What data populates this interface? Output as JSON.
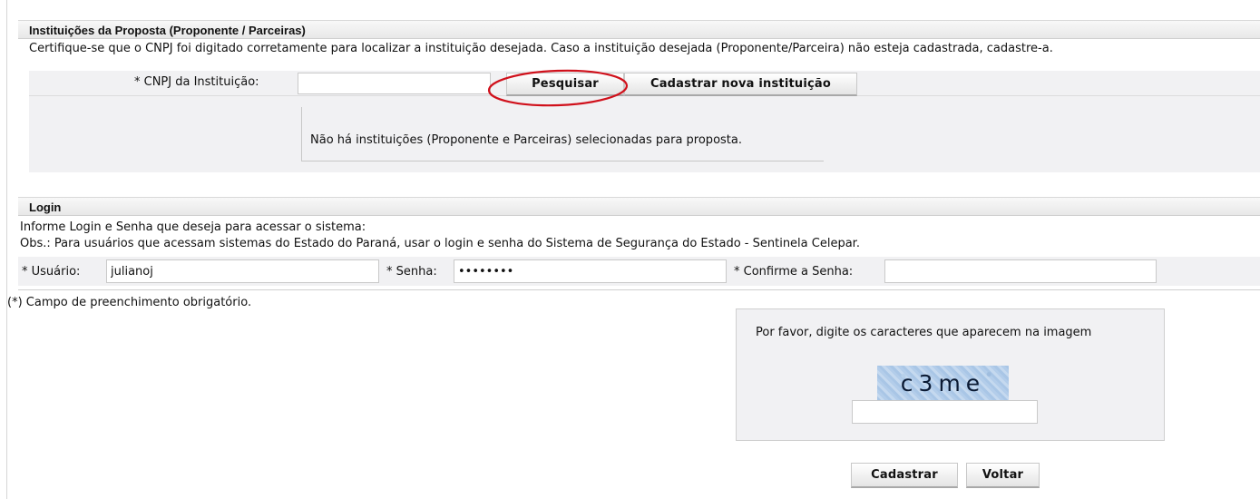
{
  "instituicoes": {
    "title": "Instituições da Proposta (Proponente / Parceiras)",
    "instruction": "Certifique-se que o CNPJ foi digitado corretamente para localizar a instituição desejada. Caso a instituição desejada (Proponente/Parceira) não esteja cadastrada, cadastre-a.",
    "cnpj_label": "* CNPJ da Instituição:",
    "cnpj_value": "",
    "search_button": "Pesquisar",
    "new_button": "Cadastrar nova instituição",
    "empty_message": "Não há instituições (Proponente e Parceiras) selecionadas para proposta."
  },
  "login": {
    "title": "Login",
    "instruction": "Informe Login e Senha que deseja para acessar o sistema:",
    "obs": "Obs.: Para usuários que acessam sistemas do Estado do Paraná, usar o login e senha do Sistema de Segurança do Estado - Sentinela Celepar.",
    "user_label": "* Usuário:",
    "user_value": "julianoj",
    "password_label": "* Senha:",
    "password_value": "••••••••",
    "confirm_label": "* Confirme a Senha:",
    "confirm_value": ""
  },
  "required_note": "(*) Campo de preenchimento obrigatório.",
  "captcha": {
    "prompt": "Por favor, digite os caracteres que aparecem na imagem",
    "image_text": "c3me",
    "input_value": ""
  },
  "actions": {
    "submit": "Cadastrar",
    "back": "Voltar"
  },
  "colors": {
    "highlight_circle": "#d0101b",
    "row_background": "#f1f1f3",
    "captcha_background": "#b3cdea"
  }
}
